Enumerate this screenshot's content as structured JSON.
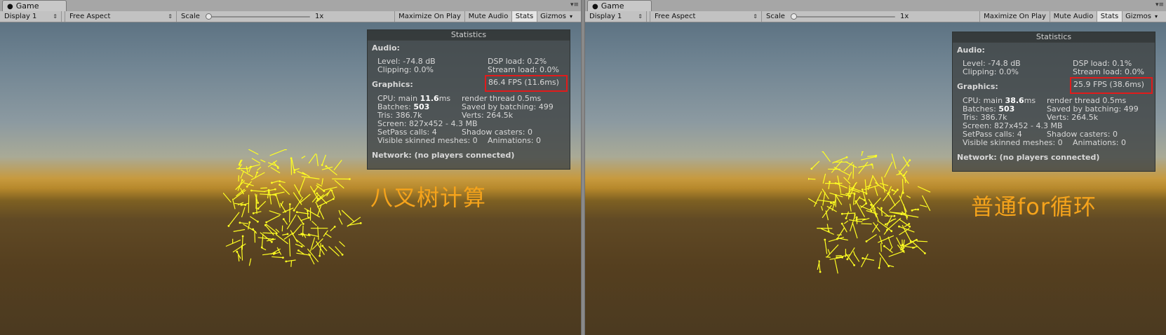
{
  "panels": [
    {
      "tab_label": "Game",
      "toolbar": {
        "display_value": "Display 1",
        "aspect_value": "Free Aspect",
        "scale_label": "Scale",
        "scale_value": "1x",
        "maximize_on_play": "Maximize On Play",
        "mute_audio": "Mute Audio",
        "stats": "Stats",
        "gizmos": "Gizmos"
      },
      "stats": {
        "title": "Statistics",
        "audio_header": "Audio:",
        "level": "Level: -74.8 dB",
        "clipping": "Clipping: 0.0%",
        "dsp_load": "DSP load: 0.2%",
        "stream_load": "Stream load: 0.0%",
        "graphics_header": "Graphics:",
        "fps": "86.4 FPS (11.6ms)",
        "cpu_prefix": "CPU: main ",
        "cpu_main": "11.6",
        "cpu_suffix": "ms",
        "render_thread": "render thread 0.5ms",
        "batches_prefix": "Batches: ",
        "batches": "503",
        "saved_by_batching": "Saved by batching: 499",
        "tris": "Tris: 386.7k",
        "verts": "Verts: 264.5k",
        "screen": "Screen: 827x452 - 4.3 MB",
        "setpass": "SetPass calls: 4",
        "shadow_casters": "Shadow casters: 0",
        "visible_skinned": "Visible skinned meshes: 0",
        "animations": "Animations: 0",
        "network": "Network: (no players connected)"
      },
      "annotation": "八叉树计算"
    },
    {
      "tab_label": "Game",
      "toolbar": {
        "display_value": "Display 1",
        "aspect_value": "Free Aspect",
        "scale_label": "Scale",
        "scale_value": "1x",
        "maximize_on_play": "Maximize On Play",
        "mute_audio": "Mute Audio",
        "stats": "Stats",
        "gizmos": "Gizmos"
      },
      "stats": {
        "title": "Statistics",
        "audio_header": "Audio:",
        "level": "Level: -74.8 dB",
        "clipping": "Clipping: 0.0%",
        "dsp_load": "DSP load: 0.1%",
        "stream_load": "Stream load: 0.0%",
        "graphics_header": "Graphics:",
        "fps": "25.9 FPS (38.6ms)",
        "cpu_prefix": "CPU: main ",
        "cpu_main": "38.6",
        "cpu_suffix": "ms",
        "render_thread": "render thread 0.5ms",
        "batches_prefix": "Batches: ",
        "batches": "503",
        "saved_by_batching": "Saved by batching: 499",
        "tris": "Tris: 386.7k",
        "verts": "Verts: 264.5k",
        "screen": "Screen: 827x452 - 4.3 MB",
        "setpass": "SetPass calls: 4",
        "shadow_casters": "Shadow casters: 0",
        "visible_skinned": "Visible skinned meshes: 0",
        "animations": "Animations: 0",
        "network": "Network: (no players connected)"
      },
      "annotation": "普通for循环"
    }
  ],
  "colors": {
    "line_segments": "#ffff22",
    "fps_highlight": "#e11b1b",
    "annotation": "#f5a31b"
  }
}
